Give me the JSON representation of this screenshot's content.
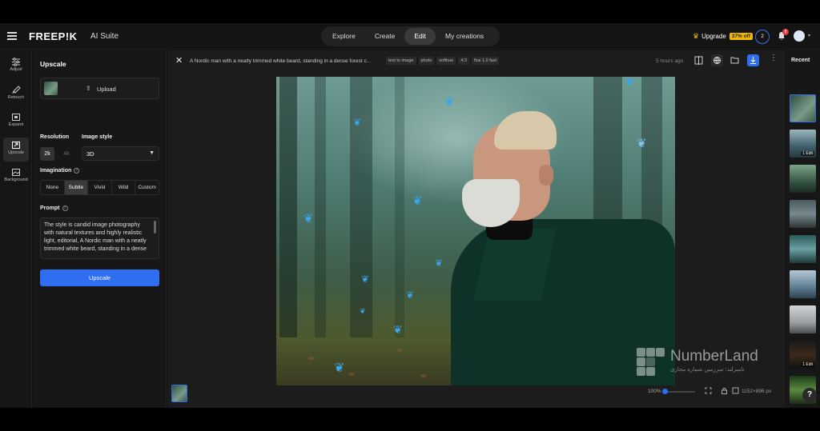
{
  "header": {
    "logo": "FREEP!K",
    "suite": "AI Suite",
    "nav": [
      {
        "label": "Explore"
      },
      {
        "label": "Create"
      },
      {
        "label": "Edit"
      },
      {
        "label": "My creations"
      }
    ],
    "active_nav": "Edit",
    "upgrade_label": "Upgrade",
    "discount": "37% off",
    "credits": "2",
    "notifications": "8"
  },
  "tools": [
    {
      "label": "Adjust",
      "icon": "sliders-icon"
    },
    {
      "label": "Retouch",
      "icon": "brush-icon"
    },
    {
      "label": "Expand",
      "icon": "expand-icon"
    },
    {
      "label": "Upscale",
      "icon": "upscale-icon"
    },
    {
      "label": "Background",
      "icon": "background-icon"
    }
  ],
  "panel": {
    "title": "Upscale",
    "upload_label": "Upload",
    "resolution_label": "Resolution",
    "resolution_options": [
      "2k",
      "4k"
    ],
    "resolution_selected": "2k",
    "image_style_label": "Image style",
    "image_style_value": "3D",
    "imagination_label": "Imagination",
    "imagination_options": [
      "None",
      "Subtle",
      "Vivid",
      "Wild",
      "Custom"
    ],
    "imagination_selected": "Subtle",
    "prompt_label": "Prompt",
    "prompt_text": "The style is candid image photography with natural textures and highly realistic light, editorial, A Nordic man with a neatly trimmed white beard, standing in a dense",
    "button_label": "Upscale"
  },
  "canvas": {
    "title": "A Nordic man with a neatly trimmed white beard, standing in a dense forest c...",
    "tags": [
      "text to image",
      "photo",
      "softhue",
      "4:3",
      "flux 1.0 fast"
    ],
    "time": "5 hours ago",
    "zoom": "100%",
    "zoom_fraction": 0.0,
    "dimensions": "1152×896 px"
  },
  "recent": {
    "title": "Recent",
    "badges": [
      "",
      "1 Edit",
      "",
      "",
      "",
      "",
      "",
      "1 Edit",
      "",
      ""
    ]
  },
  "watermark": {
    "name": "NumberLand",
    "sub": "نامبرلند؛ سرزمین شماره مجازی"
  },
  "colors": {
    "accent": "#2f6ef0",
    "upgrade": "#f2b705",
    "butterfly": "#3aa6ea"
  }
}
